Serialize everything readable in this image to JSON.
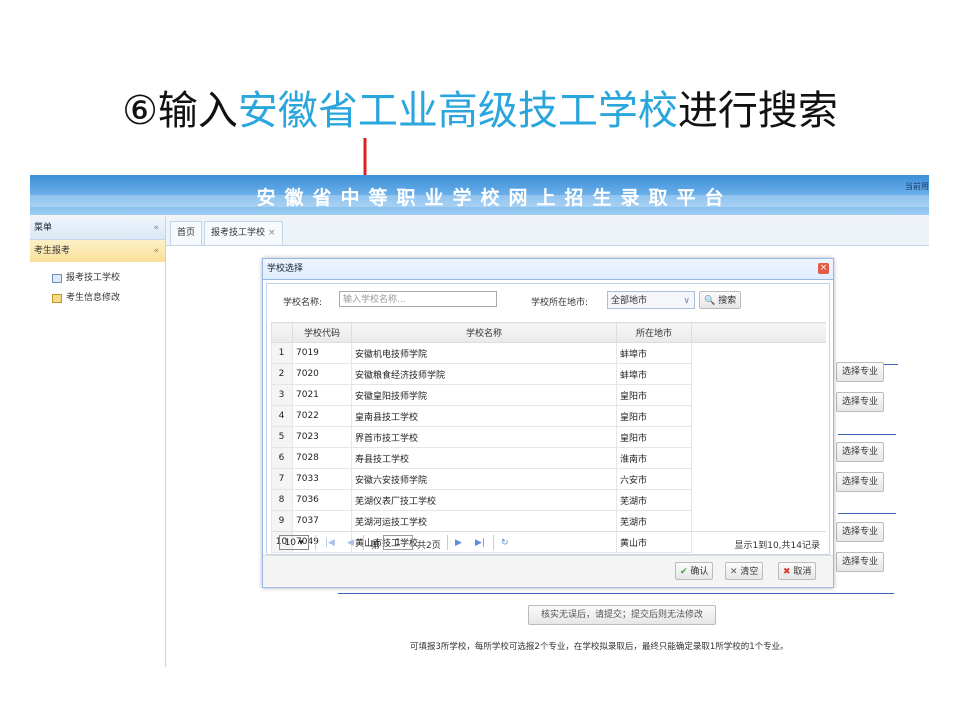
{
  "slide": {
    "circled_number": "⑥",
    "pre": "输入",
    "highlight": "安徽省工业高级技工学校",
    "post": "进行搜索",
    "highlight_color": "#2aa6dc",
    "arrow_color": "#e02020"
  },
  "header": {
    "title": "安徽省中等职业学校网上招生录取平台",
    "current_user": "当前用"
  },
  "sidebar": {
    "title": "菜单",
    "collapse_icon": "«",
    "group": "考生报考",
    "group_icon": "«",
    "items": [
      {
        "label": "报考技工学校",
        "icon": "form-icon"
      },
      {
        "label": "考生信息修改",
        "icon": "edit-icon"
      }
    ]
  },
  "tabs": [
    {
      "label": "首页"
    },
    {
      "label": "报考技工学校",
      "close": "×"
    }
  ],
  "dialog": {
    "title": "学校选择",
    "close": "×",
    "search": {
      "name_label": "学校名称:",
      "name_placeholder": "输入学校名称...",
      "city_label": "学校所在地市:",
      "city_value": "全部地市",
      "search_button": "搜索"
    },
    "columns": [
      "学校代码",
      "学校名称",
      "所在地市"
    ],
    "rows": [
      {
        "n": "1",
        "code": "7019",
        "name": "安徽机电技师学院",
        "city": "蚌埠市"
      },
      {
        "n": "2",
        "code": "7020",
        "name": "安徽粮食经济技师学院",
        "city": "蚌埠市"
      },
      {
        "n": "3",
        "code": "7021",
        "name": "安徽皇阳技师学院",
        "city": "皇阳市"
      },
      {
        "n": "4",
        "code": "7022",
        "name": "皇南县技工学校",
        "city": "皇阳市"
      },
      {
        "n": "5",
        "code": "7023",
        "name": "界首市技工学校",
        "city": "皇阳市"
      },
      {
        "n": "6",
        "code": "7028",
        "name": "寿县技工学校",
        "city": "淮南市"
      },
      {
        "n": "7",
        "code": "7033",
        "name": "安徽六安技师学院",
        "city": "六安市"
      },
      {
        "n": "8",
        "code": "7036",
        "name": "芜湖仪表厂技工学校",
        "city": "芜湖市"
      },
      {
        "n": "9",
        "code": "7037",
        "name": "芜湖河运技工学校",
        "city": "芜湖市"
      },
      {
        "n": "10",
        "code": "7049",
        "name": "黄山市技工学校",
        "city": "黄山市"
      }
    ],
    "pager": {
      "page_size": "10",
      "page_prefix": "第",
      "page": "1",
      "page_suffix": "共2页",
      "info": "显示1到10,共14记录"
    },
    "buttons": {
      "ok": "确认",
      "clear": "清空",
      "cancel": "取消"
    }
  },
  "page": {
    "select_major": "选择专业",
    "confirm_button": "核实无误后，请提交；提交后则无法修改",
    "notice": "可填报3所学校，每所学校可选报2个专业，在学校拟录取后，最终只能确定录取1所学校的1个专业。"
  }
}
